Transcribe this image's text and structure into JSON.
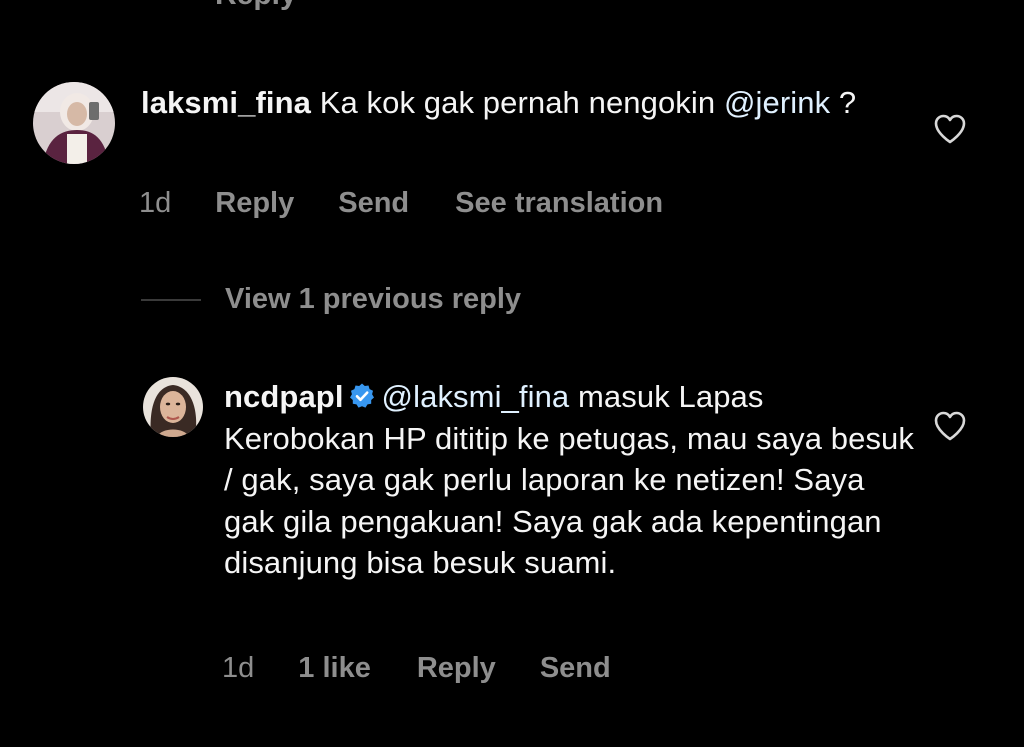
{
  "previous_comment": {
    "cut_action": "Reply"
  },
  "comment": {
    "username": "laksmi_fina",
    "text": "Ka kok gak pernah nengokin",
    "mention": "@jerink",
    "text_end": " ?",
    "time": "1d",
    "reply_label": "Reply",
    "send_label": "Send",
    "translate_label": "See translation"
  },
  "replies_toggle": {
    "label": "View 1 previous reply"
  },
  "reply": {
    "username": "ncdpapl",
    "mention": "@laksmi_fina",
    "text": " masuk Lapas Kerobokan HP dititip ke petugas, mau saya besuk / gak, saya gak perlu laporan ke netizen! Saya gak gila pengakuan! Saya gak ada kepentingan disanjung bisa besuk suami.",
    "time": "1d",
    "likes_label": "1 like",
    "reply_label": "Reply",
    "send_label": "Send"
  },
  "icons": {
    "like": "heart-outline-icon",
    "verified": "verified-badge-icon"
  },
  "colors": {
    "background": "#000000",
    "primary_text": "#f5f5f5",
    "secondary_text": "#8e8e8e",
    "mention": "#e0f1ff",
    "verified": "#3897f0"
  }
}
